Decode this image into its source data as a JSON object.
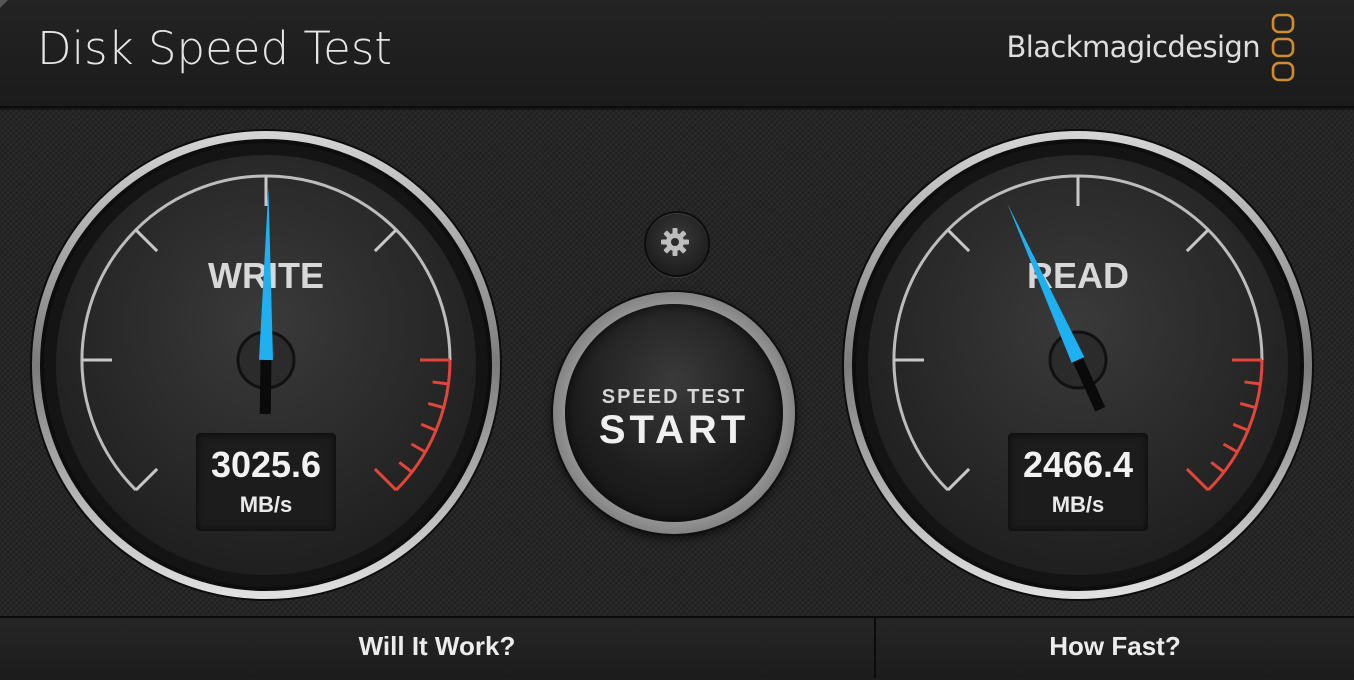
{
  "app": {
    "title": "Disk Speed Test",
    "brand": "Blackmagicdesign"
  },
  "gauges": {
    "write": {
      "label": "WRITE",
      "value": "3025.6",
      "unit": "MB/s",
      "needle_level": 0.503
    },
    "read": {
      "label": "READ",
      "value": "2466.4",
      "unit": "MB/s",
      "needle_level": 0.41
    }
  },
  "start_button": {
    "top_label": "SPEED TEST",
    "main_label": "START"
  },
  "tabs": [
    {
      "label": "Will It Work?"
    },
    {
      "label": "How Fast?"
    }
  ],
  "colors": {
    "needle": "#1fb0f2",
    "redline": "#e2463a",
    "logo": "#d08b2a"
  },
  "icons": {
    "settings": "gear-icon",
    "logo": "blackmagic-logo-icon"
  }
}
